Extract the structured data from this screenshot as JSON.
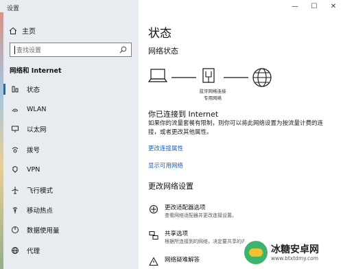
{
  "window": {
    "title": "设置",
    "controls": {
      "minimize": "—",
      "maximize": "☐",
      "close": "✕"
    }
  },
  "sidebar": {
    "home_label": "主页",
    "search_placeholder": "查找设置",
    "section_title": "网络和 Internet",
    "items": [
      {
        "label": "状态",
        "icon": "globe-icon",
        "active": true
      },
      {
        "label": "WLAN",
        "icon": "wifi-icon",
        "active": false
      },
      {
        "label": "以太网",
        "icon": "ethernet-icon",
        "active": false
      },
      {
        "label": "拨号",
        "icon": "dialup-icon",
        "active": false
      },
      {
        "label": "VPN",
        "icon": "vpn-icon",
        "active": false
      },
      {
        "label": "飞行模式",
        "icon": "airplane-icon",
        "active": false
      },
      {
        "label": "移动热点",
        "icon": "hotspot-icon",
        "active": false
      },
      {
        "label": "数据使用量",
        "icon": "data-usage-icon",
        "active": false
      },
      {
        "label": "代理",
        "icon": "proxy-globe-icon",
        "active": false
      }
    ]
  },
  "main": {
    "page_title": "状态",
    "network_status_title": "网络状态",
    "network_name_line1": "蓝牙网络连接",
    "network_name_line2": "专用网络",
    "connected_title": "你已连接到 Internet",
    "description": "如果你的流量套餐有限制，则你可以将此网络设置为按流量计费的连接，或者更改其他属性。",
    "link_change_props": "更改连接属性",
    "link_show_networks": "显示可用网络",
    "change_settings_title": "更改网络设置",
    "options": [
      {
        "title": "更改适配器选项",
        "subtitle": "查看网络适配器并更改连接设置。",
        "icon": "adapter-icon"
      },
      {
        "title": "共享选项",
        "subtitle": "根据所连接到的网络，决定要共享的内",
        "icon": "sharing-icon"
      },
      {
        "title": "网络疑难解答",
        "subtitle": "",
        "icon": "warning-icon"
      }
    ]
  },
  "watermark": {
    "name": "冰糖安卓网",
    "url": "www.btxtdmy.com"
  },
  "colors": {
    "accent": "#2565b4",
    "link": "#1a5fb4",
    "sidebar_bg": "#e8ebef"
  }
}
